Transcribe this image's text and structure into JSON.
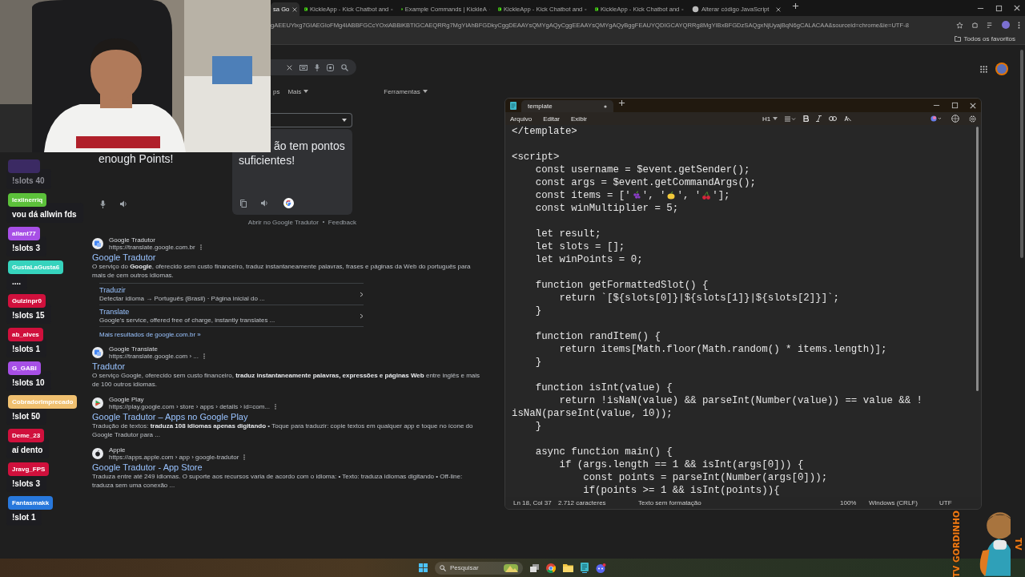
{
  "browser": {
    "tabs": [
      {
        "title": "sa Go",
        "selected": true
      },
      {
        "title": "KickleApp - Kick Chatbot and",
        "selected": false
      },
      {
        "title": "Example Commands | KickleA",
        "selected": false
      },
      {
        "title": "KickleApp - Kick Chatbot and",
        "selected": false
      },
      {
        "title": "KickleApp - Kick Chatbot and",
        "selected": false
      },
      {
        "title": "Alterar código JavaScript",
        "selected": false
      }
    ],
    "address": "gAEEUYixg7GIAEGIoFMg4IABBFGCcYOxiABBiKBTIGCAEQRRg7MgYIAhBFGDkyCggDEAAYsQMYgAQyCggEEAAYsQMYgAQyBggFEAUYQDIGCAYQRRg8MgYIBxBFGDzSAQgxNjUyajBqN6gCALACAA&sourceid=chrome&ie=UTF-8",
    "all_bookmarks": "Todos os favoritos"
  },
  "search_page": {
    "filters": [
      {
        "label": "ps",
        "dropdown": false
      },
      {
        "label": "Mais",
        "dropdown": true
      },
      {
        "label": "Ferramentas",
        "dropdown": true
      }
    ],
    "translate": {
      "source_text": "enough Points!",
      "target_text": "ão tem pontos suficientes!",
      "open_link": "Abrir no Google Tradutor",
      "feedback": "Feedback"
    },
    "results": [
      {
        "kind": "translate",
        "site": "Google Tradutor",
        "url": "https://translate.google.com.br",
        "title": "Google Tradutor",
        "snippet": "O serviço do **Google**, oferecido sem custo financeiro, traduz instantaneamente palavras, frases e páginas da Web do português para mais de cem outros idiomas.",
        "sitelinks": [
          {
            "title": "Traduzir",
            "snippet": "Detectar idioma → Português (Brasil) · Página inicial do ..."
          },
          {
            "title": "Translate",
            "snippet": "Google's service, offered free of charge, instantly translates ..."
          }
        ],
        "more": "Mais resultados de google.com.br »"
      },
      {
        "kind": "translate",
        "site": "Google Translate",
        "url": "https://translate.google.com › ...",
        "title": "Tradutor",
        "snippet": "O serviço Google, oferecido sem custo financeiro, **traduz instantaneamente palavras, expressões e páginas Web** entre inglês e mais de 100 outros idiomas."
      },
      {
        "kind": "play",
        "site": "Google Play",
        "url": "https://play.google.com › store › apps › details › id=com...",
        "title": "Google Tradutor – Apps no Google Play",
        "snippet": "Tradução de textos: **traduza 108 idiomas apenas digitando** • Toque para traduzir: copie textos em qualquer app e toque no ícone do Google Tradutor para ..."
      },
      {
        "kind": "apple",
        "site": "Apple",
        "url": "https://apps.apple.com › app › google-tradutor",
        "title": "Google Tradutor - App Store",
        "snippet": "Traduza entre até 249 idiomas. O suporte aos recursos varia de acordo com o idioma: • Texto: traduza idiomas digitando • Off-line: traduza sem uma conexão ..."
      }
    ]
  },
  "notepad": {
    "tab": "template",
    "menu": [
      "Arquivo",
      "Editar",
      "Exibir"
    ],
    "heading": "H1",
    "lines": [
      {
        "kind": "code",
        "text": "</template>"
      },
      {
        "kind": "blank"
      },
      {
        "kind": "code",
        "text": "<script>"
      },
      {
        "kind": "code",
        "text": "    const username = $event.getSender();"
      },
      {
        "kind": "code",
        "text": "    const args = $event.getCommandArgs();"
      },
      {
        "kind": "fruits",
        "parts": [
          "    const items = ['",
          "', '",
          "', '",
          "'];"
        ]
      },
      {
        "kind": "code",
        "text": "    const winMultiplier = 5;"
      },
      {
        "kind": "blank"
      },
      {
        "kind": "code",
        "text": "    let result;"
      },
      {
        "kind": "code",
        "text": "    let slots = [];"
      },
      {
        "kind": "code",
        "text": "    let winPoints = 0;"
      },
      {
        "kind": "blank"
      },
      {
        "kind": "code",
        "text": "    function getFormattedSlot() {"
      },
      {
        "kind": "code",
        "text": "        return `[${slots[0]}|${slots[1]}|${slots[2]}]`;"
      },
      {
        "kind": "code",
        "text": "    }"
      },
      {
        "kind": "blank"
      },
      {
        "kind": "code",
        "text": "    function randItem() {"
      },
      {
        "kind": "code",
        "text": "        return items[Math.floor(Math.random() * items.length)];"
      },
      {
        "kind": "code",
        "text": "    }"
      },
      {
        "kind": "blank"
      },
      {
        "kind": "code",
        "text": "    function isInt(value) {"
      },
      {
        "kind": "code",
        "text": "        return !isNaN(value) && parseInt(Number(value)) == value && !"
      },
      {
        "kind": "code",
        "text": "isNaN(parseInt(value, 10));"
      },
      {
        "kind": "code",
        "text": "    }"
      },
      {
        "kind": "blank"
      },
      {
        "kind": "code",
        "text": "    async function main() {"
      },
      {
        "kind": "code",
        "text": "        if (args.length == 1 && isInt(args[0])) {"
      },
      {
        "kind": "code",
        "text": "            const points = parseInt(Number(args[0]));"
      },
      {
        "kind": "code",
        "text": "            if(points >= 1 && isInt(points)){"
      }
    ],
    "status": [
      "Ln 18, Col 37",
      "2.712 caracteres",
      "Texto sem formatação",
      "100%",
      "Windows (CRLF)",
      "UTF"
    ]
  },
  "chat": [
    {
      "color": "#3b2a63",
      "message": "!slots 40",
      "faded": true
    },
    {
      "user": "lexiinerriq",
      "color": "#5cc13a",
      "message": "vou dá allwin fds",
      "faded": false
    },
    {
      "user": "allant77",
      "color": "#a74fe6",
      "message": "!slots 3",
      "faded": false
    },
    {
      "user": "GustaLaGusta6",
      "color": "#36d3bd",
      "message": "....",
      "faded": false
    },
    {
      "user": "Gulzinpr0",
      "color": "#d0103c",
      "message": "!slots 15",
      "faded": false
    },
    {
      "user": "ab_alves",
      "color": "#d0103c",
      "message": "!slots 1",
      "faded": false
    },
    {
      "user": "G_GABI",
      "color": "#a74fe6",
      "message": "!slots 10",
      "faded": false
    },
    {
      "user": "CobradorImprecado",
      "color": "#f0c070",
      "message": "!slot 50",
      "faded": false
    },
    {
      "user": "Deme_23",
      "color": "#d0103c",
      "message": "aí dento",
      "faded": false
    },
    {
      "user": "Jravg_FPS",
      "color": "#d0103c",
      "message": "!slots 3",
      "faded": false
    },
    {
      "user": "Fantasmakk",
      "color": "#2878dc",
      "message": "!slot 1",
      "faded": false
    }
  ],
  "taskbar": {
    "search": "Pesquisar"
  },
  "mascot": {
    "left_text": "TV GORDINHO",
    "right_text": "TV"
  }
}
